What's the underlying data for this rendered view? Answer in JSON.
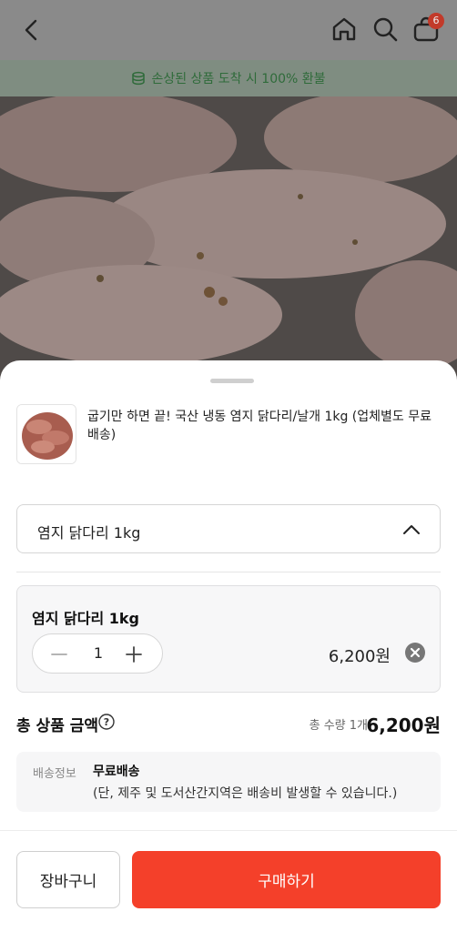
{
  "header": {
    "cart_count": "6",
    "icons": [
      "back-arrow-icon",
      "home-icon",
      "search-icon",
      "cart-icon"
    ]
  },
  "notice": {
    "text": "손상된 상품 도착 시 100% 환불",
    "icon": "coins-icon"
  },
  "product": {
    "name": "굽기만 하면 끝! 국산 냉동 염지 닭다리/날개 1kg (업체별도 무료배송)"
  },
  "option_select": {
    "selected": "염지 닭다리 1kg"
  },
  "selected_option": {
    "title": "염지 닭다리 1kg",
    "quantity": "1",
    "price": "6,200원"
  },
  "total": {
    "label": "총 상품 금액",
    "quantity": "총 수량 1개",
    "price": "6,200원"
  },
  "shipping": {
    "label": "배송정보",
    "value": "무료배송",
    "note": "(단, 제주 및 도서산간지역은 배송비 발생할 수 있습니다.)"
  },
  "actions": {
    "cart_label": "장바구니",
    "buy_label": "구매하기"
  },
  "colors": {
    "accent": "#f4402a",
    "notice_text": "#2f6b3a",
    "badge": "#e8503a"
  }
}
